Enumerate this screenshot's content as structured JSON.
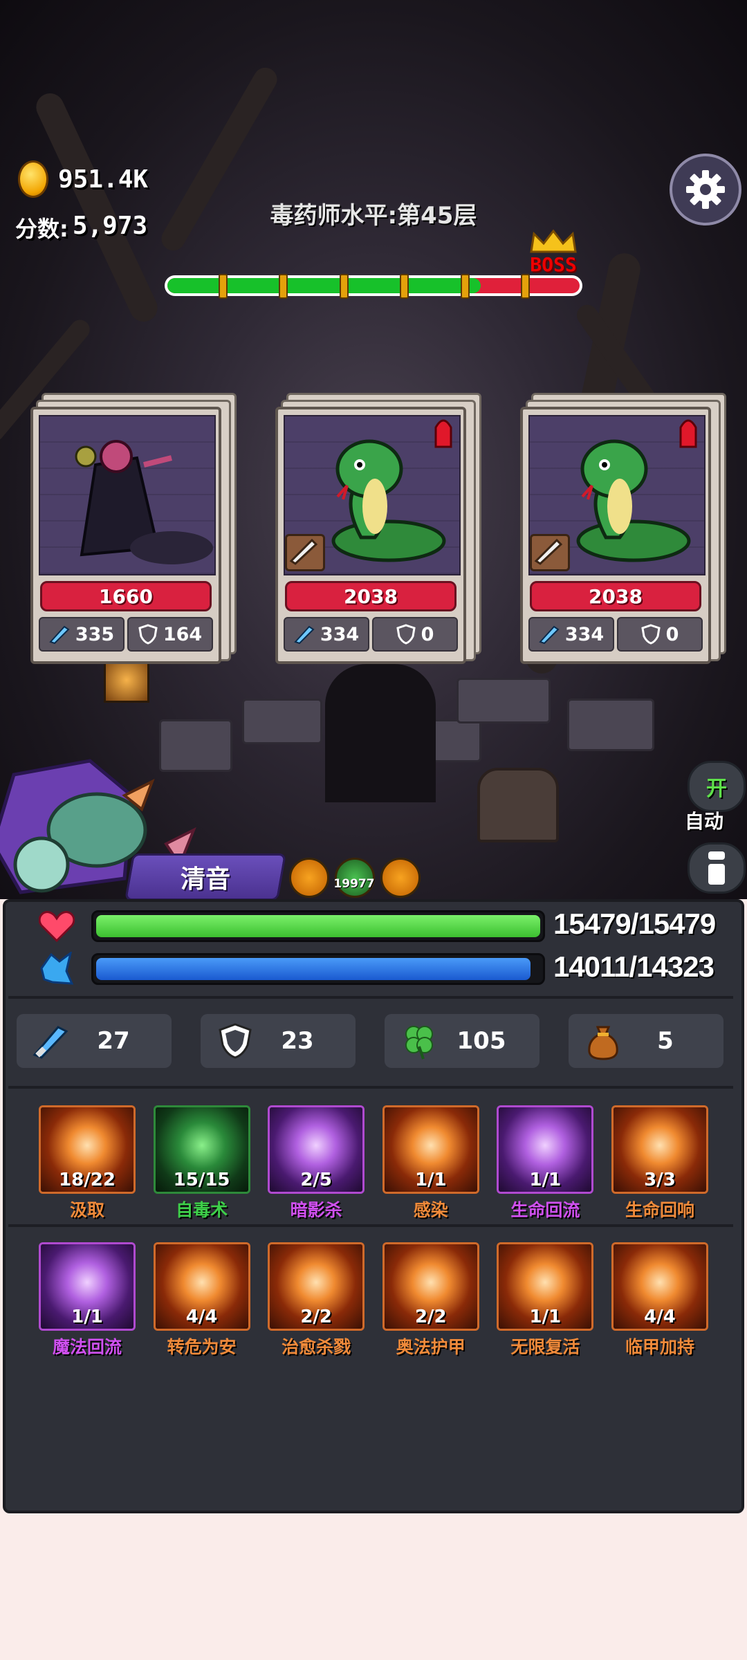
{
  "hud": {
    "gold": "951.4K",
    "score_label": "分数:",
    "score_value": "5,973",
    "level_title": "毒药师水平:第45层",
    "boss_label": "BOSS",
    "progress_green_fraction": 0.76
  },
  "enemies": [
    {
      "name": "witch",
      "hp": "1660",
      "attack": "335",
      "defense": "164",
      "has_alert": false,
      "has_weapon_badge": false
    },
    {
      "name": "cobra",
      "hp": "2038",
      "attack": "334",
      "defense": "0",
      "has_alert": true,
      "has_weapon_badge": true
    },
    {
      "name": "cobra",
      "hp": "2038",
      "attack": "334",
      "defense": "0",
      "has_alert": true,
      "has_weapon_badge": true
    }
  ],
  "controls": {
    "auto_toggle": "开",
    "auto_label": "自动",
    "info_icon": "info-icon",
    "settings_icon": "gear-icon"
  },
  "hero": {
    "name": "清音",
    "buff_count": "19977"
  },
  "vitals": {
    "hp_text": "15479/15479",
    "hp_fraction": 1.0,
    "mp_text": "14011/14323",
    "mp_fraction": 0.978
  },
  "attributes": [
    {
      "icon": "sword-icon",
      "value": "27"
    },
    {
      "icon": "shield-icon",
      "value": "23"
    },
    {
      "icon": "clover-icon",
      "value": "105"
    },
    {
      "icon": "money-bag-icon",
      "value": "5"
    }
  ],
  "skills": [
    {
      "name": "汲取",
      "count": "18/22",
      "name_color": "#f08a3a",
      "style": "orange"
    },
    {
      "name": "自毒术",
      "count": "15/15",
      "name_color": "#3ed04a",
      "style": "green"
    },
    {
      "name": "暗影杀",
      "count": "2/5",
      "name_color": "#d050f0",
      "style": "purple"
    },
    {
      "name": "感染",
      "count": "1/1",
      "name_color": "#f08a3a",
      "style": "orange"
    },
    {
      "name": "生命回流",
      "count": "1/1",
      "name_color": "#d050f0",
      "style": "purple"
    },
    {
      "name": "生命回响",
      "count": "3/3",
      "name_color": "#f08a3a",
      "style": "orange"
    },
    {
      "name": "魔法回流",
      "count": "1/1",
      "name_color": "#d050f0",
      "style": "purple"
    },
    {
      "name": "转危为安",
      "count": "4/4",
      "name_color": "#f08a3a",
      "style": "orange"
    },
    {
      "name": "治愈杀戮",
      "count": "2/2",
      "name_color": "#f08a3a",
      "style": "orange"
    },
    {
      "name": "奥法护甲",
      "count": "2/2",
      "name_color": "#f08a3a",
      "style": "orange"
    },
    {
      "name": "无限复活",
      "count": "1/1",
      "name_color": "#f08a3a",
      "style": "orange"
    },
    {
      "name": "临甲加持",
      "count": "4/4",
      "name_color": "#f08a3a",
      "style": "orange"
    }
  ],
  "colors": {
    "hp_bar": "#5be04a",
    "mp_bar": "#2f7ee8",
    "enemy_hp": "#d9213f",
    "panel_bg": "#2e3038"
  }
}
